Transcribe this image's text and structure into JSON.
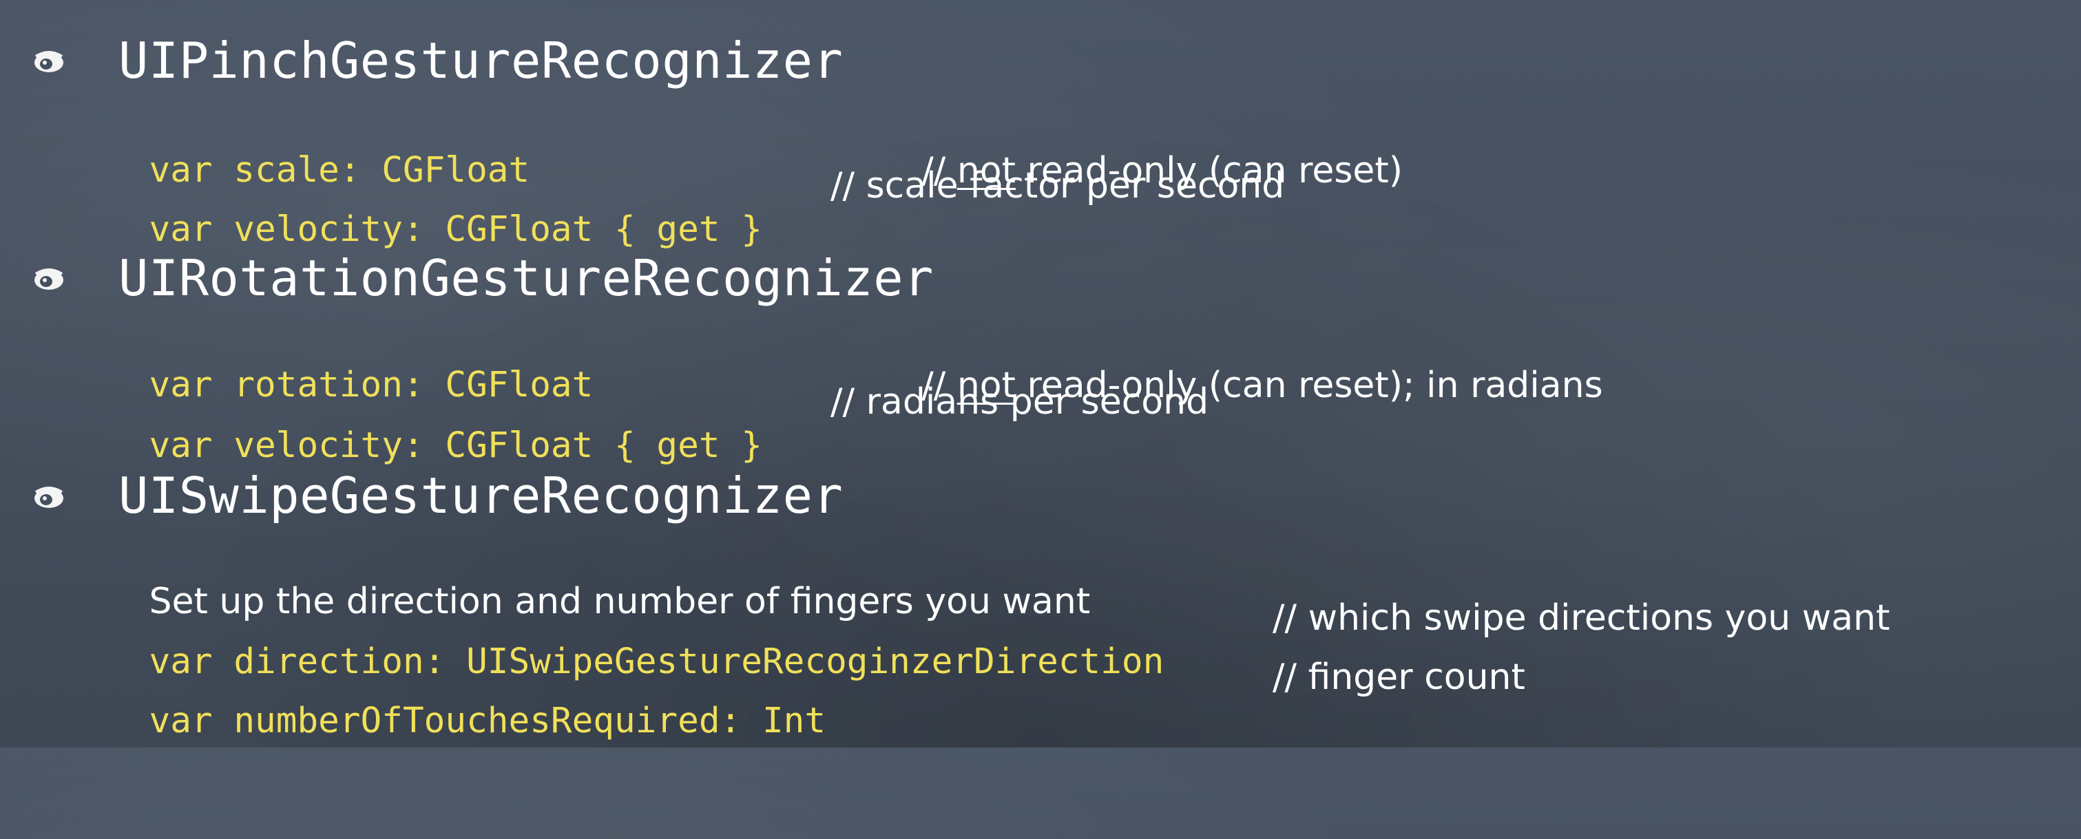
{
  "colors": {
    "background": "#45505f",
    "code": "#f0e05a",
    "text": "#ffffff"
  },
  "sections": [
    {
      "bullet_icon": "eye-bullet-icon",
      "heading": "UIPinchGestureRecognizer",
      "lines": [
        {
          "code": "var scale: CGFloat",
          "comment_prefix": "// ",
          "comment_underlined": "not",
          "comment_rest": " read-only (can reset)"
        },
        {
          "code": "var velocity: CGFloat { get }",
          "comment": "// scale factor per second"
        }
      ]
    },
    {
      "bullet_icon": "eye-bullet-icon",
      "heading": "UIRotationGestureRecognizer",
      "lines": [
        {
          "code": "var rotation: CGFloat",
          "comment_prefix": "// ",
          "comment_underlined": "not",
          "comment_rest": " read-only (can reset); in radians"
        },
        {
          "code": "var velocity: CGFloat { get }",
          "comment": "// radians per second"
        }
      ]
    },
    {
      "bullet_icon": "eye-bullet-icon",
      "heading": "UISwipeGestureRecognizer",
      "description": "Set up the direction and number of fingers you want",
      "lines": [
        {
          "code": "var direction: UISwipeGestureRecoginzerDirection",
          "comment": "// which swipe directions you want"
        },
        {
          "code": "var numberOfTouchesRequired: Int",
          "comment": "// finger count"
        }
      ]
    }
  ]
}
